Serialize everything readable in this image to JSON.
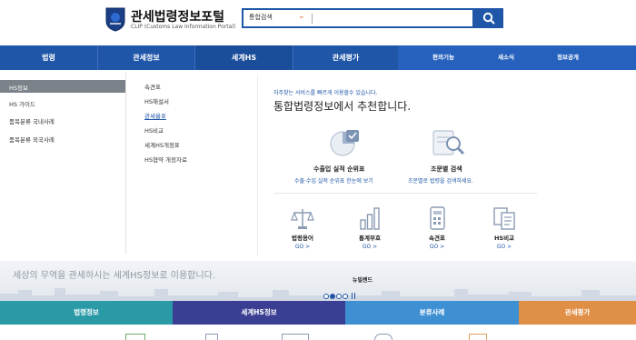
{
  "header": {
    "title": "관세법령정보포털",
    "subtitle": "CLIP (Customs Law Information Portal)",
    "search": {
      "scope_label": "통합검색",
      "query": ""
    }
  },
  "nav": {
    "main": [
      "법령",
      "관세정보",
      "세계HS",
      "관세평가"
    ],
    "active": "세계HS",
    "utility": [
      "편의기능",
      "새소식",
      "정보공개"
    ]
  },
  "dropdown": {
    "side_items": [
      "HS정보",
      "HS 가이드",
      "품목분류 국내사례",
      "품목분류 외국사례"
    ],
    "side_active": "HS정보",
    "sub_items": [
      "속견표",
      "HS해설서",
      "관세율표",
      "HS비교",
      "세계HS개정표",
      "HS협약 개정자료"
    ],
    "sub_active": "관세율표",
    "recommend_note": "자주찾는 서비스를 빠르게 이용할수 있습니다.",
    "recommend_title": "통합법령정보에서 추천합니다.",
    "features": [
      {
        "title": "수출입 실적 순위표",
        "desc": "수출·수입 실적 순위표 한눈에 보기",
        "icon": "pie-chart-icon"
      },
      {
        "title": "조문별 검색",
        "desc": "조문별로 법령을 검색하세요.",
        "icon": "document-search-icon"
      }
    ],
    "quick_links": [
      {
        "label": "법령용어",
        "go": "GO >",
        "icon": "scale-icon"
      },
      {
        "label": "통계부호",
        "go": "GO >",
        "icon": "bar-chart-icon"
      },
      {
        "label": "속견표",
        "go": "GO >",
        "icon": "calculator-icon"
      },
      {
        "label": "HS비교",
        "go": "GO >",
        "icon": "compare-docs-icon"
      }
    ]
  },
  "banner": {
    "text": "세상의 무역을 관세하시는 세계HS정보로 이용합니다.",
    "news_label": "뉴빌랜드",
    "slide_dots": 4,
    "active_dot": 2
  },
  "bottom_tabs": [
    {
      "label": "법령정보",
      "color": "#2a9aa7"
    },
    {
      "label": "세계HS정보",
      "color": "#3b3f93"
    },
    {
      "label": "분류사례",
      "color": "#3f8fd3"
    },
    {
      "label": "관세평가",
      "color": "#e08f47"
    }
  ],
  "colors": {
    "primary": "#1f56a8",
    "accent": "#e0632a"
  }
}
